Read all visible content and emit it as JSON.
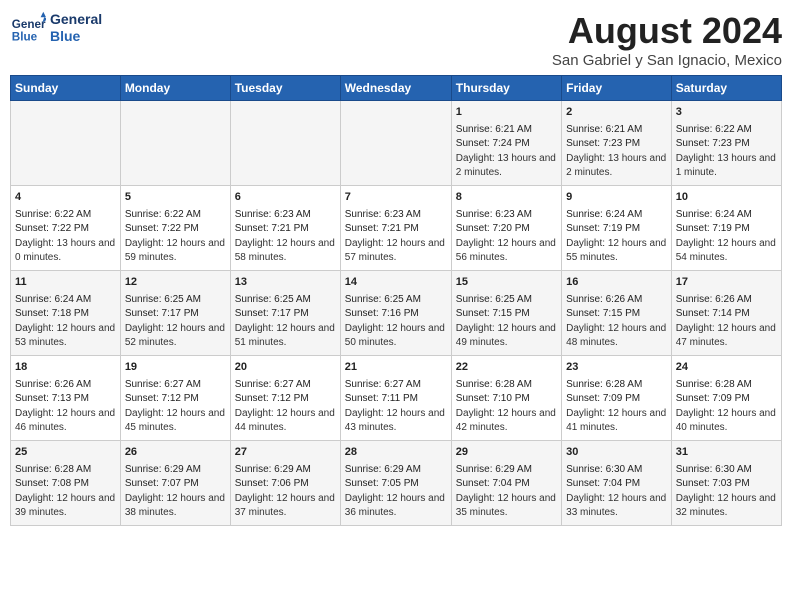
{
  "header": {
    "logo_line1": "General",
    "logo_line2": "Blue",
    "title": "August 2024",
    "subtitle": "San Gabriel y San Ignacio, Mexico"
  },
  "weekdays": [
    "Sunday",
    "Monday",
    "Tuesday",
    "Wednesday",
    "Thursday",
    "Friday",
    "Saturday"
  ],
  "weeks": [
    [
      {
        "day": "",
        "sunrise": "",
        "sunset": "",
        "daylight": ""
      },
      {
        "day": "",
        "sunrise": "",
        "sunset": "",
        "daylight": ""
      },
      {
        "day": "",
        "sunrise": "",
        "sunset": "",
        "daylight": ""
      },
      {
        "day": "",
        "sunrise": "",
        "sunset": "",
        "daylight": ""
      },
      {
        "day": "1",
        "sunrise": "Sunrise: 6:21 AM",
        "sunset": "Sunset: 7:24 PM",
        "daylight": "Daylight: 13 hours and 2 minutes."
      },
      {
        "day": "2",
        "sunrise": "Sunrise: 6:21 AM",
        "sunset": "Sunset: 7:23 PM",
        "daylight": "Daylight: 13 hours and 2 minutes."
      },
      {
        "day": "3",
        "sunrise": "Sunrise: 6:22 AM",
        "sunset": "Sunset: 7:23 PM",
        "daylight": "Daylight: 13 hours and 1 minute."
      }
    ],
    [
      {
        "day": "4",
        "sunrise": "Sunrise: 6:22 AM",
        "sunset": "Sunset: 7:22 PM",
        "daylight": "Daylight: 13 hours and 0 minutes."
      },
      {
        "day": "5",
        "sunrise": "Sunrise: 6:22 AM",
        "sunset": "Sunset: 7:22 PM",
        "daylight": "Daylight: 12 hours and 59 minutes."
      },
      {
        "day": "6",
        "sunrise": "Sunrise: 6:23 AM",
        "sunset": "Sunset: 7:21 PM",
        "daylight": "Daylight: 12 hours and 58 minutes."
      },
      {
        "day": "7",
        "sunrise": "Sunrise: 6:23 AM",
        "sunset": "Sunset: 7:21 PM",
        "daylight": "Daylight: 12 hours and 57 minutes."
      },
      {
        "day": "8",
        "sunrise": "Sunrise: 6:23 AM",
        "sunset": "Sunset: 7:20 PM",
        "daylight": "Daylight: 12 hours and 56 minutes."
      },
      {
        "day": "9",
        "sunrise": "Sunrise: 6:24 AM",
        "sunset": "Sunset: 7:19 PM",
        "daylight": "Daylight: 12 hours and 55 minutes."
      },
      {
        "day": "10",
        "sunrise": "Sunrise: 6:24 AM",
        "sunset": "Sunset: 7:19 PM",
        "daylight": "Daylight: 12 hours and 54 minutes."
      }
    ],
    [
      {
        "day": "11",
        "sunrise": "Sunrise: 6:24 AM",
        "sunset": "Sunset: 7:18 PM",
        "daylight": "Daylight: 12 hours and 53 minutes."
      },
      {
        "day": "12",
        "sunrise": "Sunrise: 6:25 AM",
        "sunset": "Sunset: 7:17 PM",
        "daylight": "Daylight: 12 hours and 52 minutes."
      },
      {
        "day": "13",
        "sunrise": "Sunrise: 6:25 AM",
        "sunset": "Sunset: 7:17 PM",
        "daylight": "Daylight: 12 hours and 51 minutes."
      },
      {
        "day": "14",
        "sunrise": "Sunrise: 6:25 AM",
        "sunset": "Sunset: 7:16 PM",
        "daylight": "Daylight: 12 hours and 50 minutes."
      },
      {
        "day": "15",
        "sunrise": "Sunrise: 6:25 AM",
        "sunset": "Sunset: 7:15 PM",
        "daylight": "Daylight: 12 hours and 49 minutes."
      },
      {
        "day": "16",
        "sunrise": "Sunrise: 6:26 AM",
        "sunset": "Sunset: 7:15 PM",
        "daylight": "Daylight: 12 hours and 48 minutes."
      },
      {
        "day": "17",
        "sunrise": "Sunrise: 6:26 AM",
        "sunset": "Sunset: 7:14 PM",
        "daylight": "Daylight: 12 hours and 47 minutes."
      }
    ],
    [
      {
        "day": "18",
        "sunrise": "Sunrise: 6:26 AM",
        "sunset": "Sunset: 7:13 PM",
        "daylight": "Daylight: 12 hours and 46 minutes."
      },
      {
        "day": "19",
        "sunrise": "Sunrise: 6:27 AM",
        "sunset": "Sunset: 7:12 PM",
        "daylight": "Daylight: 12 hours and 45 minutes."
      },
      {
        "day": "20",
        "sunrise": "Sunrise: 6:27 AM",
        "sunset": "Sunset: 7:12 PM",
        "daylight": "Daylight: 12 hours and 44 minutes."
      },
      {
        "day": "21",
        "sunrise": "Sunrise: 6:27 AM",
        "sunset": "Sunset: 7:11 PM",
        "daylight": "Daylight: 12 hours and 43 minutes."
      },
      {
        "day": "22",
        "sunrise": "Sunrise: 6:28 AM",
        "sunset": "Sunset: 7:10 PM",
        "daylight": "Daylight: 12 hours and 42 minutes."
      },
      {
        "day": "23",
        "sunrise": "Sunrise: 6:28 AM",
        "sunset": "Sunset: 7:09 PM",
        "daylight": "Daylight: 12 hours and 41 minutes."
      },
      {
        "day": "24",
        "sunrise": "Sunrise: 6:28 AM",
        "sunset": "Sunset: 7:09 PM",
        "daylight": "Daylight: 12 hours and 40 minutes."
      }
    ],
    [
      {
        "day": "25",
        "sunrise": "Sunrise: 6:28 AM",
        "sunset": "Sunset: 7:08 PM",
        "daylight": "Daylight: 12 hours and 39 minutes."
      },
      {
        "day": "26",
        "sunrise": "Sunrise: 6:29 AM",
        "sunset": "Sunset: 7:07 PM",
        "daylight": "Daylight: 12 hours and 38 minutes."
      },
      {
        "day": "27",
        "sunrise": "Sunrise: 6:29 AM",
        "sunset": "Sunset: 7:06 PM",
        "daylight": "Daylight: 12 hours and 37 minutes."
      },
      {
        "day": "28",
        "sunrise": "Sunrise: 6:29 AM",
        "sunset": "Sunset: 7:05 PM",
        "daylight": "Daylight: 12 hours and 36 minutes."
      },
      {
        "day": "29",
        "sunrise": "Sunrise: 6:29 AM",
        "sunset": "Sunset: 7:04 PM",
        "daylight": "Daylight: 12 hours and 35 minutes."
      },
      {
        "day": "30",
        "sunrise": "Sunrise: 6:30 AM",
        "sunset": "Sunset: 7:04 PM",
        "daylight": "Daylight: 12 hours and 33 minutes."
      },
      {
        "day": "31",
        "sunrise": "Sunrise: 6:30 AM",
        "sunset": "Sunset: 7:03 PM",
        "daylight": "Daylight: 12 hours and 32 minutes."
      }
    ]
  ]
}
